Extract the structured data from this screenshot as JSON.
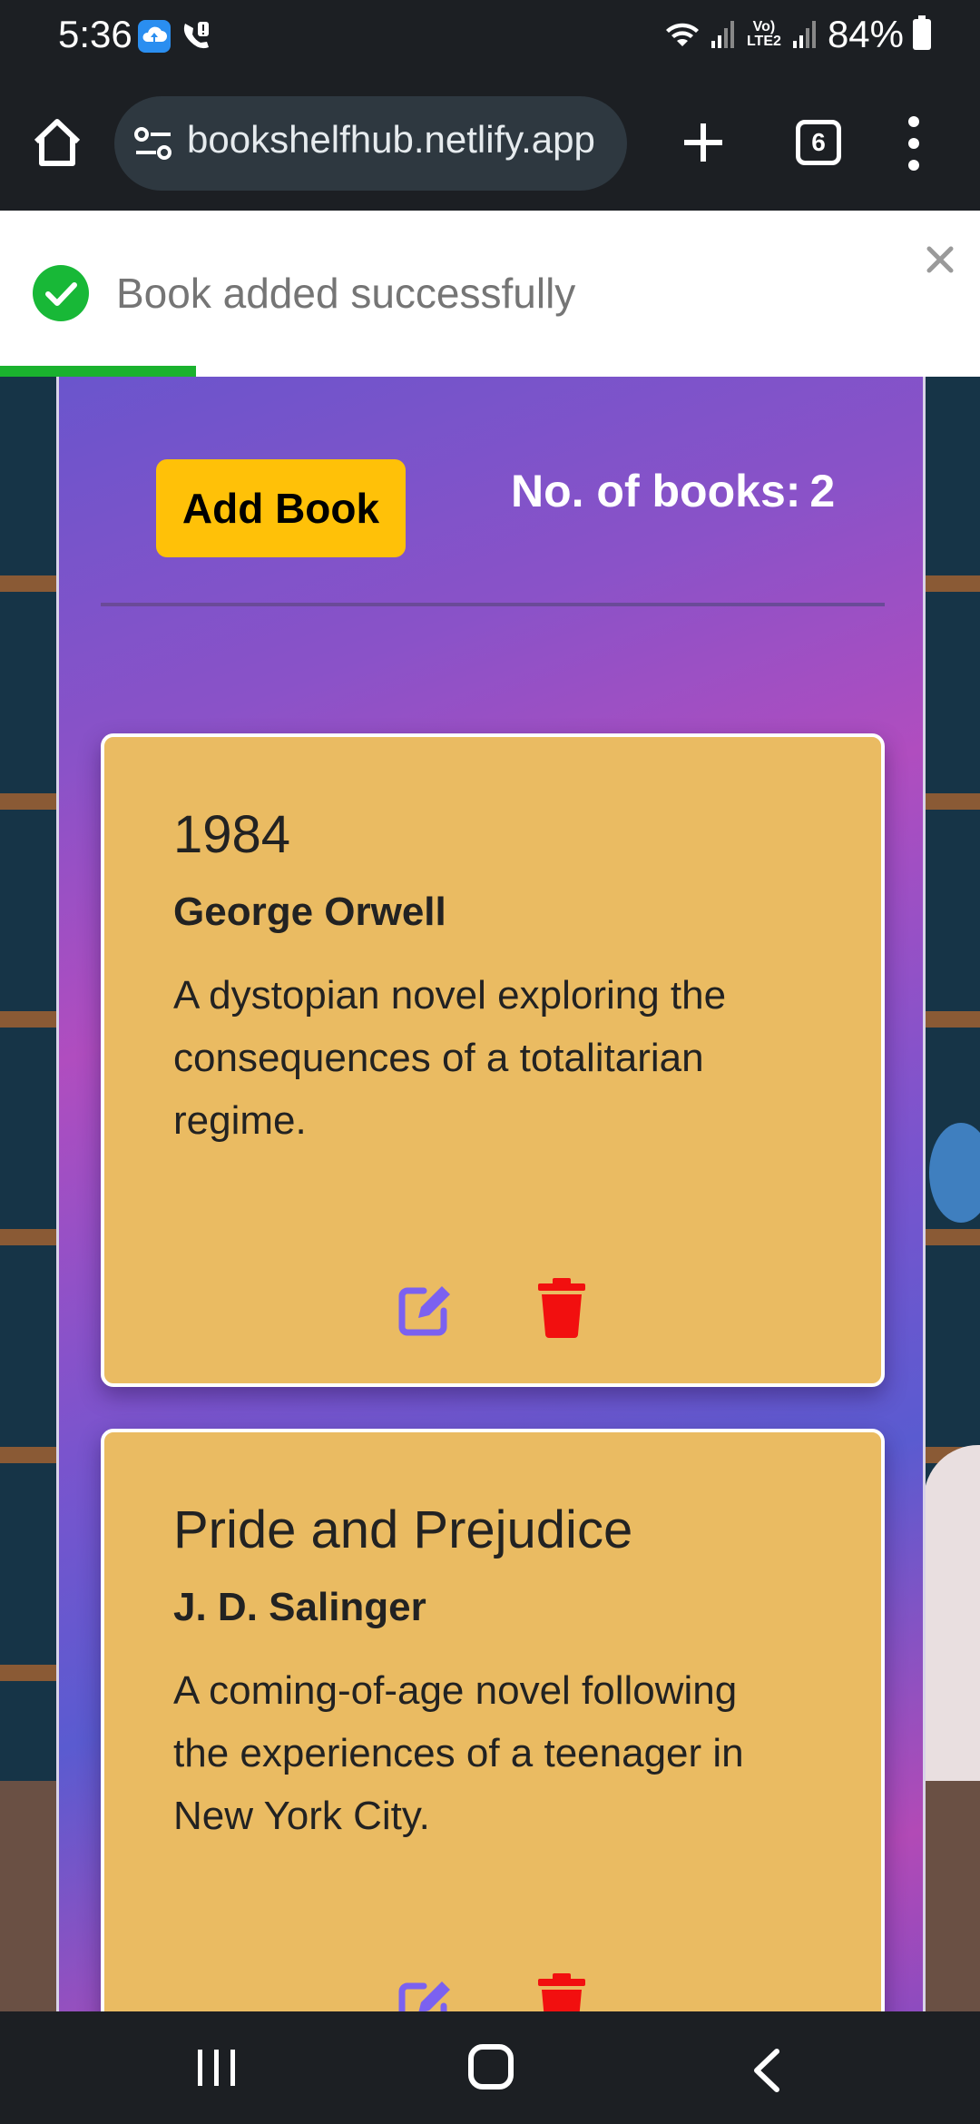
{
  "status_bar": {
    "time": "5:36",
    "network": "Vo) LTE2",
    "battery": "84%"
  },
  "browser": {
    "url": "bookshelfhub.netlify.app",
    "tab_count": "6"
  },
  "toast": {
    "message": "Book added successfully",
    "progress": 0.2
  },
  "header": {
    "add_button_label": "Add Book",
    "count_label": "No. of books:",
    "count_value": "2"
  },
  "books": [
    {
      "title": "1984",
      "author": "George Orwell",
      "description": "A dystopian novel exploring the consequences of a totalitarian regime."
    },
    {
      "title": "Pride and Prejudice",
      "author": "J. D. Salinger",
      "description": "A coming-of-age novel following the experiences of a teenager in New York City."
    }
  ],
  "colors": {
    "add_button": "#ffc108",
    "card": "#eabb62",
    "edit_icon": "#7b61f0",
    "delete_icon": "#f20f0f",
    "toast_success": "#18b837"
  },
  "icons": {
    "edit": "pen-to-square-icon",
    "delete": "trash-icon",
    "success": "check-circle-icon",
    "close": "close-icon"
  }
}
